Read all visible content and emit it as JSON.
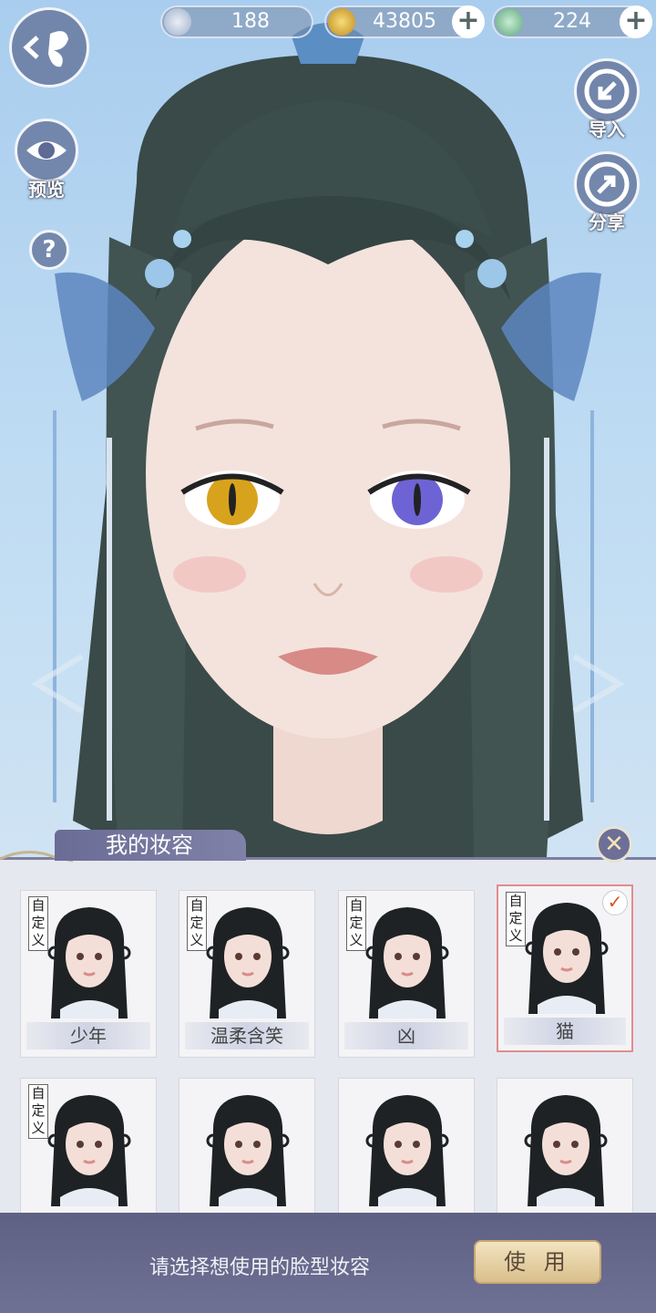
{
  "currencies": [
    {
      "icon": "silver-coin-icon",
      "value": "188"
    },
    {
      "icon": "gold-coin-icon",
      "value": "43805"
    },
    {
      "icon": "jade-token-icon",
      "value": "224"
    }
  ],
  "side_buttons": {
    "preview_label": "预览",
    "import_label": "导入",
    "share_label": "分享",
    "help_symbol": "?"
  },
  "panel": {
    "title": "我的妆容",
    "close_symbol": "✕",
    "badge_text": "自定义",
    "selected_mark": "✓",
    "presets": [
      {
        "name": "少年",
        "custom": true,
        "selected": false
      },
      {
        "name": "温柔含笑",
        "custom": true,
        "selected": false
      },
      {
        "name": "凶",
        "custom": true,
        "selected": false
      },
      {
        "name": "猫",
        "custom": true,
        "selected": true
      },
      {
        "name": "",
        "custom": true,
        "selected": false
      },
      {
        "name": "",
        "custom": false,
        "selected": false
      },
      {
        "name": "",
        "custom": false,
        "selected": false
      },
      {
        "name": "",
        "custom": false,
        "selected": false
      }
    ]
  },
  "footer": {
    "hint": "请选择想使用的脸型妆容",
    "use_label": "使 用"
  },
  "colors": {
    "panel_accent": "#6b6c95",
    "use_button": "#e6cf9f",
    "selected_border": "#e28d8d"
  }
}
